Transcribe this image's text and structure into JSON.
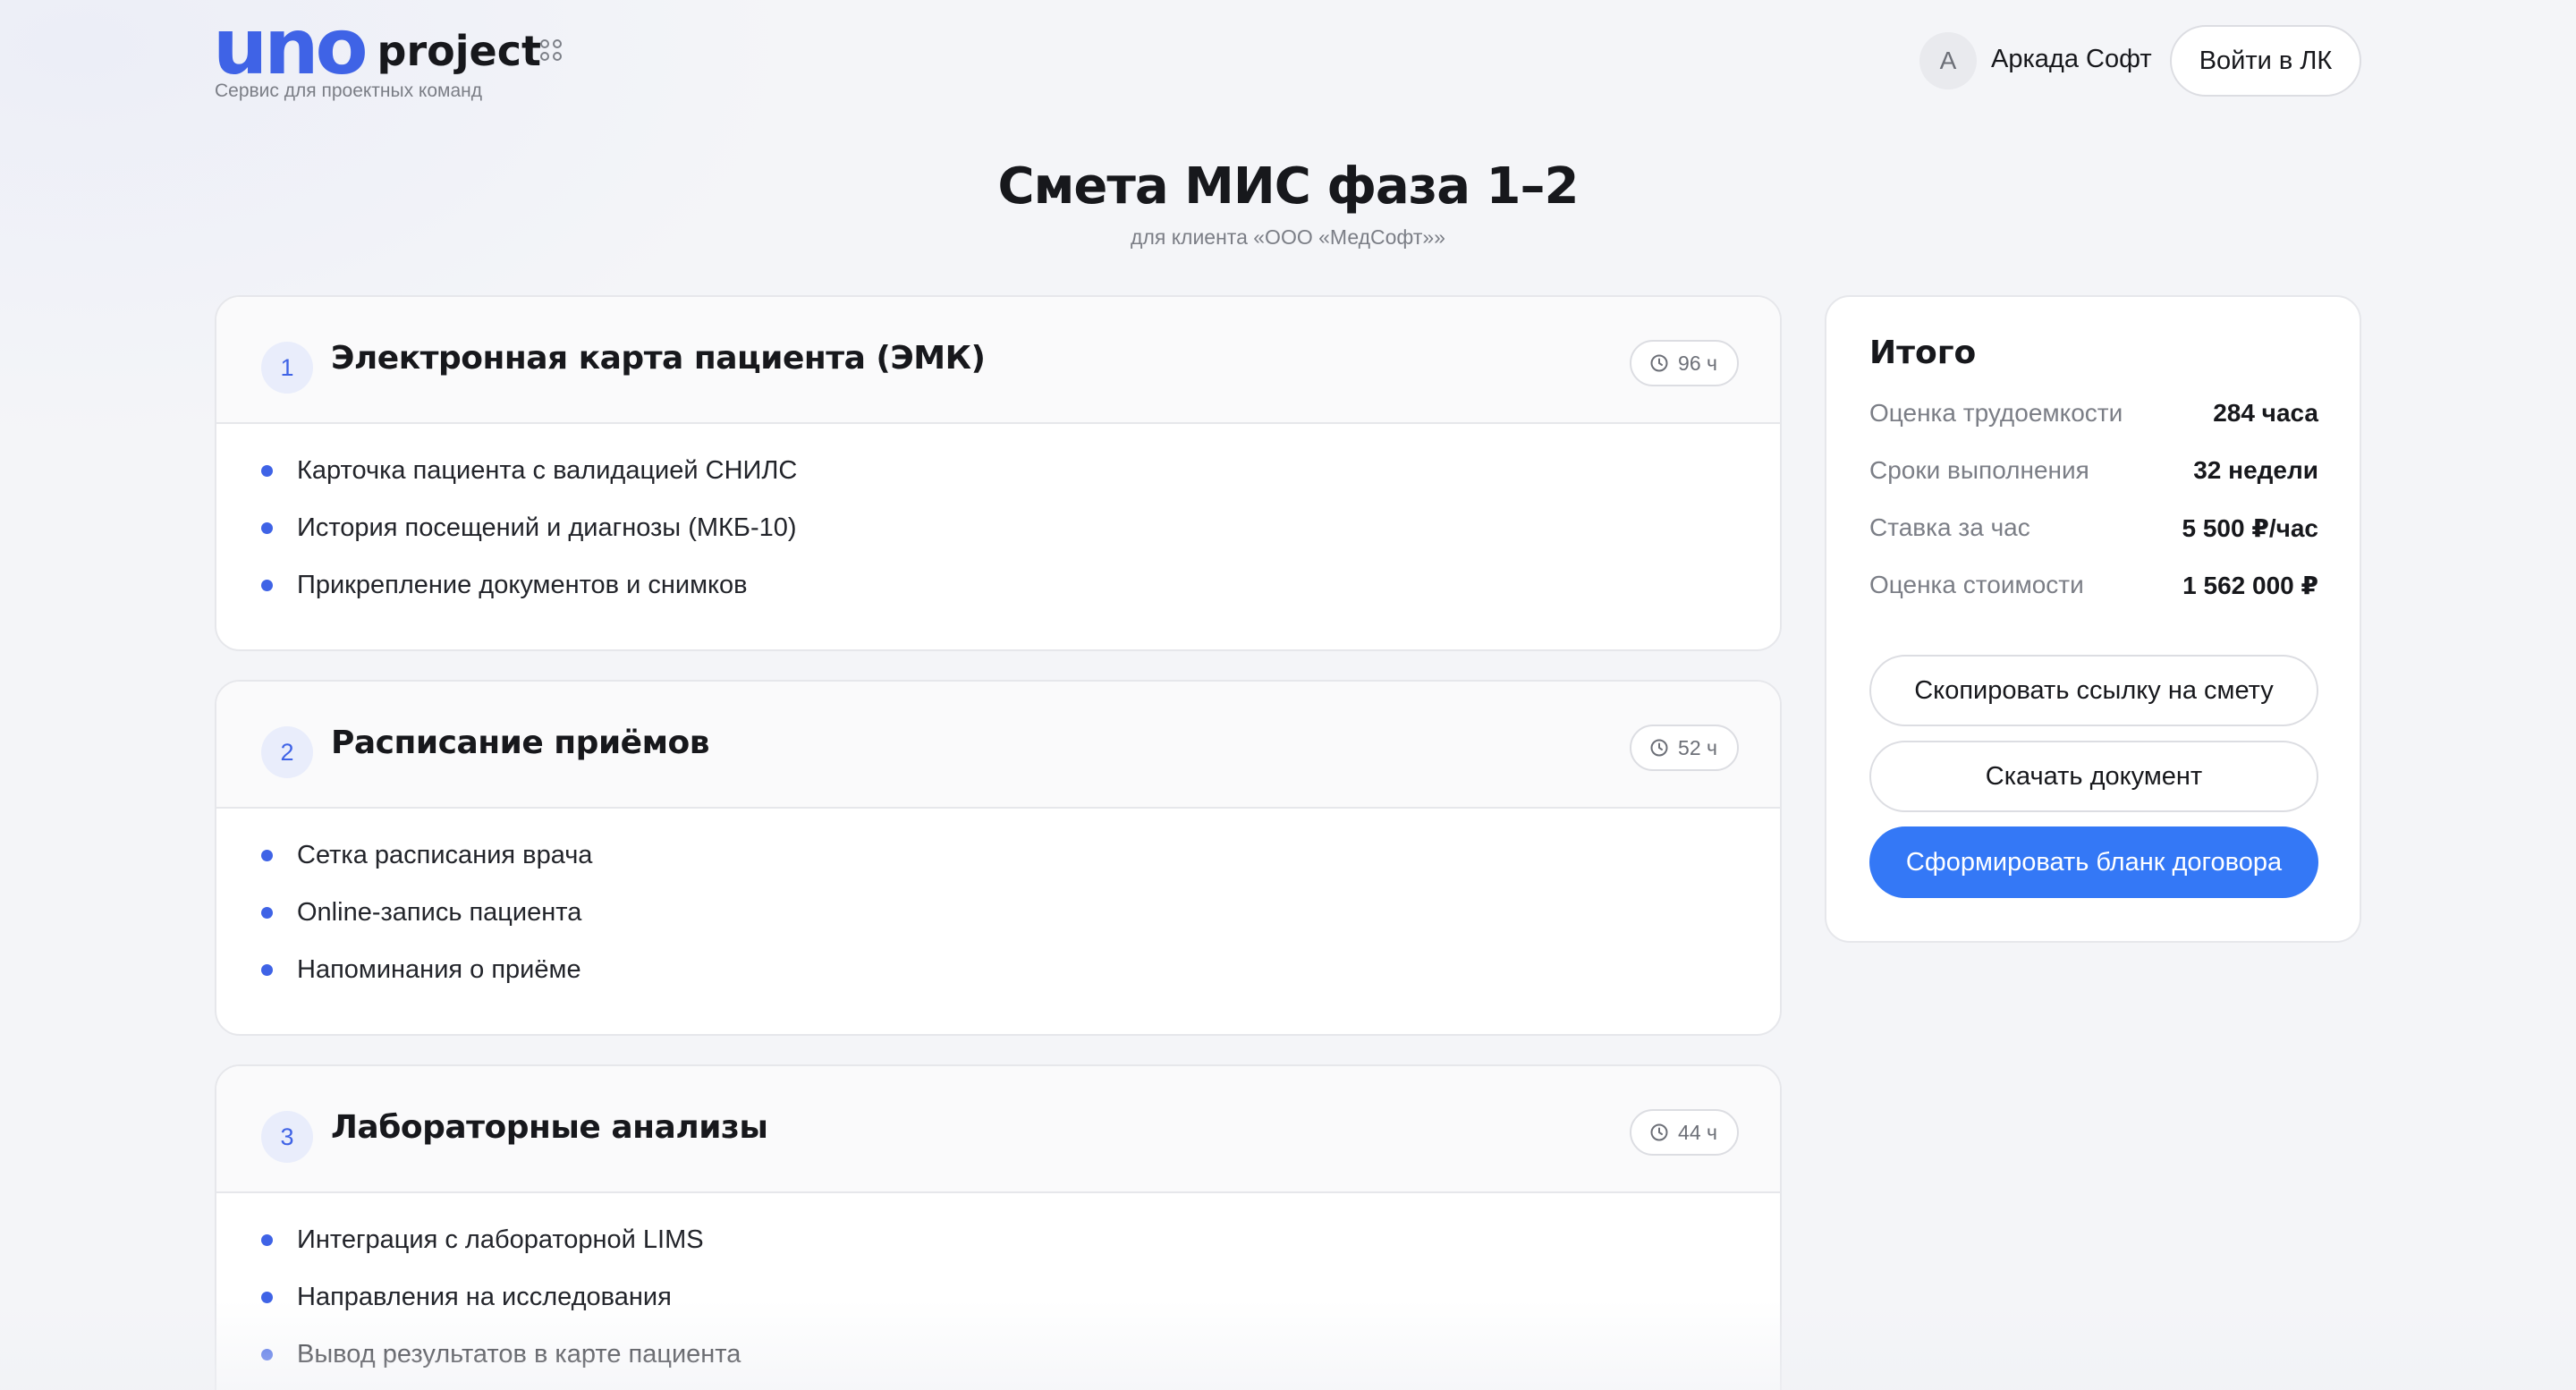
{
  "header": {
    "logo_uno": "uno",
    "logo_project": "project",
    "tagline": "Сервис для проектных команд",
    "avatar_letter": "А",
    "company": "Аркада Софт",
    "login_label": "Войти в ЛК"
  },
  "page": {
    "title": "Смета МИС фаза 1–2",
    "subtitle": "для клиента «ООО «МедСофт»»"
  },
  "sections": [
    {
      "number": "1",
      "title": "Электронная карта пациента (ЭМК)",
      "hours": "96 ч",
      "items": [
        "Карточка пациента с валидацией СНИЛС",
        "История посещений и диагнозы (МКБ-10)",
        "Прикрепление документов и снимков"
      ]
    },
    {
      "number": "2",
      "title": "Расписание приёмов",
      "hours": "52 ч",
      "items": [
        "Сетка расписания врача",
        "Online-запись пациента",
        "Напоминания о приёме"
      ]
    },
    {
      "number": "3",
      "title": "Лабораторные анализы",
      "hours": "44 ч",
      "items": [
        "Интеграция с лабораторной LIMS",
        "Направления на исследования",
        "Вывод результатов в карте пациента"
      ]
    }
  ],
  "summary": {
    "title": "Итого",
    "rows": [
      {
        "label": "Оценка трудоемкости",
        "value": "284 часа"
      },
      {
        "label": "Сроки выполнения",
        "value": "32 недели"
      },
      {
        "label": "Ставка за час",
        "value": "5 500 ₽/час"
      },
      {
        "label": "Оценка стоимости",
        "value": "1 562 000 ₽"
      }
    ],
    "copy_link_label": "Скопировать ссылку на смету",
    "download_label": "Скачать документ",
    "contract_label": "Сформировать бланк договора"
  },
  "colors": {
    "accent": "#3f63e6",
    "primary_button": "#3478f6",
    "background": "#f4f5f8"
  },
  "icons": {
    "apps": "apps-grid-icon",
    "clock": "clock-icon",
    "bullet": "bullet-dot-icon"
  }
}
